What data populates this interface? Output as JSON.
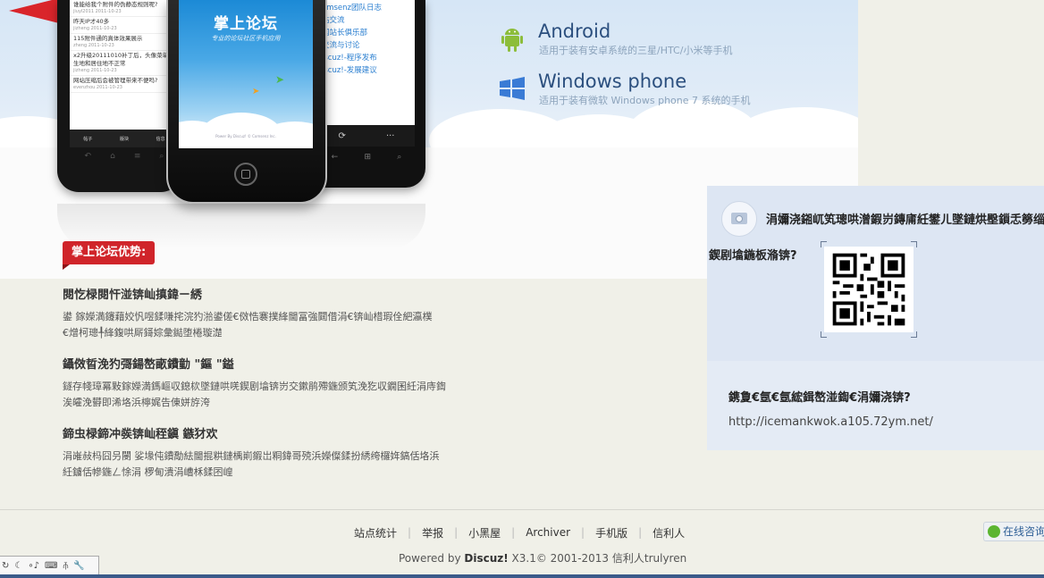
{
  "phones": {
    "left_rows": [
      {
        "text": "谁能给我个附件的伪静态规则呢?",
        "meta": "jiuyl2011  2011-10-23"
      },
      {
        "text": "昨天IP才40多",
        "meta": "jizheng  2011-10-23"
      },
      {
        "text": "115附件通的真体效果展示",
        "meta": "zheng  2011-10-23"
      },
      {
        "text": "x2升级20111010补丁后，头像菜单出生地和居住地不正常",
        "meta": "jizheng  2011-10-23"
      },
      {
        "text": "网站压缩后会被管理带来不便吗?",
        "meta": "evenzhou  2011-10-23"
      }
    ],
    "left_tabs": [
      "帖子",
      "版块",
      "信息"
    ],
    "mid_title": "掌上论坛",
    "mid_subtitle": "专业的论坛社区手机应用",
    "mid_powered": "Power By Discuz! © Comsenz Inc.",
    "right_lines": [
      {
        "text": "omsenz团队日志",
        "meta": ""
      },
      {
        "text": "站交流",
        "meta": ""
      },
      {
        "text": "国站长俱乐部",
        "meta": ""
      },
      {
        "text": "交流与讨论",
        "meta": ""
      },
      {
        "text": "iscuz!-程序发布",
        "meta": ""
      },
      {
        "text": "iscuz!-发展建议",
        "meta": ""
      }
    ]
  },
  "platforms": [
    {
      "name": "Android",
      "desc": "适用于装有安卓系统的三星/HTC/小米等手机"
    },
    {
      "name": "Windows phone",
      "desc": "适用于装有微软 Windows phone 7 系统的手机"
    }
  ],
  "advantages": {
    "badge": "掌上论坛优势:",
    "items": [
      {
        "title": "閱忔椂閱忓湴锛屾搷鍏ㄧ綉",
        "text": "鍙   鎵嬫満鑳藉姣忛喅鍒嗛挓浣犳湁鍙傞€傚悎褰撲綘閫冨強閮借涓€锛屾棤瑕佺紦瀛樸€熷柯璁╀綘鍑哄厛鎶婃彙鐑堕棬璇濋"
      },
      {
        "title": "鑷傚晢浼犳彁鍚嶅畞鐨勭 \"鏂 \"鎰",
        "text": "鐩存帴璋冪敤鎵嬫満鎷嶇収鎴栨墜鏈哄唴鍥剧墖锛岃交鏉鹃殢鍦颁笂浼犵収鐗囷紝涓庤鍧涘皬浼欎即浠垎浜檸娓告倲姘斿洿"
      },
      {
        "title": "鍗虫椂鍗冲彂锛屾秷鎭 鏃犲欢",
        "text": "涓嶉敊杩囧叧閿  娑堟伅鐨勪紶閫掍粠鏈楀崱鍜岀粡鍏哥殑浜嬫儏鍒扮綉绔欏姩鎬佸垎浜紝鐪佸幓鍦ㄥ悇涓 椤甸潰涓嶆柇鍒囨崲"
      }
    ]
  },
  "side": {
    "scan_title": "涓嬭浇鎺屼笂璁哄潧鍜岃鏄庯紝鐢ㄦ墜鏈烘壂鎻忎簩缁寸爜",
    "scan_label": "鍥剧墖鍦板潃锛?",
    "link_label": "鎸夐€氬€氬綋鍓嶅湴鍧€涓嬭浇锛?",
    "link_url": "http://icemankwok.a105.72ym.net/"
  },
  "footer": {
    "nav": [
      "站点统计",
      "举报",
      "小黑屋",
      "Archiver",
      "手机版",
      "信利人"
    ],
    "powered_prefix": "Powered by ",
    "powered_brand": "Discuz!",
    "powered_suffix": " X3.1© 2001-2013 信利人trulyren",
    "online_label": "在线咨询"
  },
  "colors": {
    "accent_red": "#d0242a",
    "link_blue": "#2b4f7e",
    "panel_bg": "#e4ebf5"
  }
}
